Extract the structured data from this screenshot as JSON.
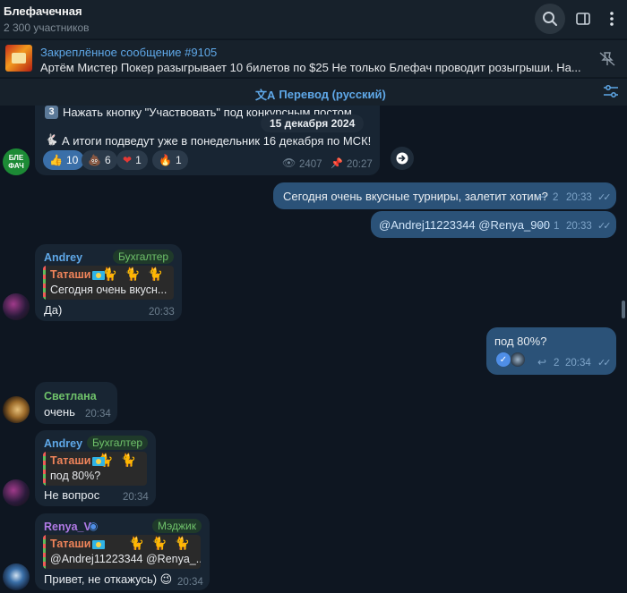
{
  "header": {
    "title": "Блефачечная",
    "subtitle": "2 300 участников"
  },
  "pinned": {
    "title": "Закреплённое сообщение #9105",
    "text": "Артём Мистер Покер разыгрывает 10 билетов по $25   Не только Блефач проводит розыгрыши. На..."
  },
  "translate": {
    "label": "Перевод (русский)"
  },
  "channel_post": {
    "avatar_text": "БЛЕ ФАЧ",
    "line1_prefix": "3",
    "line1": "Нажать кнопку \"Участвовать\" под конкурсным постом",
    "date_pill": "15 декабря 2024",
    "line2": "А итоги подведут уже в понедельник 16 декабря по МСК!",
    "reactions": [
      {
        "emoji": "👍",
        "count": "10"
      },
      {
        "emoji": "💩",
        "count": "6"
      },
      {
        "emoji": "❤",
        "count": "1"
      },
      {
        "emoji": "🔥",
        "count": "1"
      }
    ],
    "views": "2407",
    "time": "20:27"
  },
  "messages": {
    "out1": {
      "text": "Сегодня очень вкусные турниры, залетит хотим?",
      "replies": "2",
      "time": "20:33"
    },
    "out2": {
      "text": "@Andrej11223344 @Renya_900",
      "replies": "1",
      "time": "20:33"
    },
    "andrey1": {
      "sender": "Andrey",
      "role": "Бухгалтер",
      "reply_name": "Таташи",
      "reply_text": "Сегодня очень вкусн...",
      "text": "Да)",
      "time": "20:33"
    },
    "out3": {
      "text": "под 80%?",
      "replies": "2",
      "time": "20:34"
    },
    "svetlana": {
      "sender": "Светлана",
      "text": "очень",
      "time": "20:34"
    },
    "andrey2": {
      "sender": "Andrey",
      "role": "Бухгалтер",
      "reply_name": "Таташи",
      "reply_text": "под 80%?",
      "text": "Не вопрос",
      "time": "20:34"
    },
    "renya": {
      "sender": "Renya_V",
      "role": "Мэджик",
      "reply_name": "Таташи",
      "reply_text": "@Andrej11223344 @Renya_...",
      "text": "Привет, не откажусь) 😉",
      "time": "20:34"
    }
  },
  "colors": {
    "background": "#0e1621",
    "panel": "#17212b",
    "incoming": "#182533",
    "outgoing": "#2b5278",
    "accent": "#5fa8e8"
  }
}
